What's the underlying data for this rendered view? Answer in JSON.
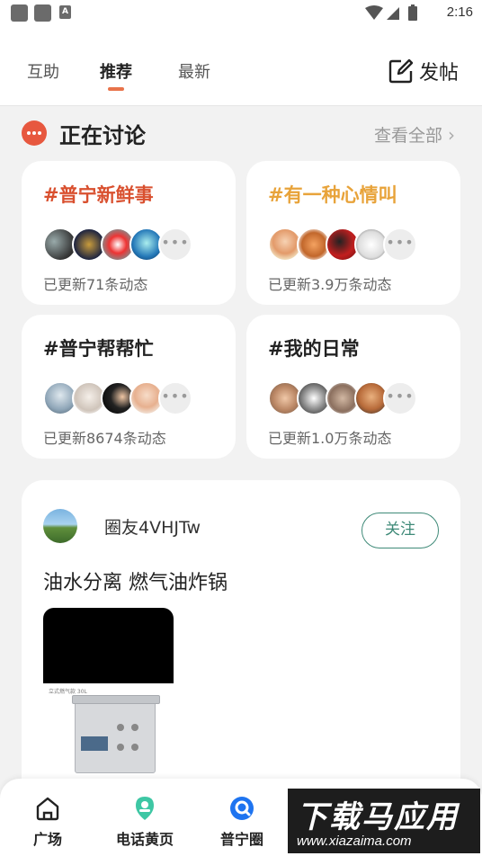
{
  "status_bar": {
    "time": "2:16",
    "a_icon": "A"
  },
  "header": {
    "tabs": [
      {
        "label": "互助",
        "active": false
      },
      {
        "label": "推荐",
        "active": true
      },
      {
        "label": "最新",
        "active": false
      }
    ],
    "post_button_label": "发帖",
    "accent_color": "#e8734a"
  },
  "discussing": {
    "title": "正在讨论",
    "see_all": "查看全部",
    "topics": [
      {
        "title": "#普宁新鲜事",
        "subtitle": "已更新71条动态",
        "title_color": "#d9502f"
      },
      {
        "title": "#有一种心情叫",
        "subtitle": "已更新3.9万条动态",
        "title_color": "#e8a33a"
      },
      {
        "title": "#普宁帮帮忙",
        "subtitle": "已更新8674条动态",
        "title_color": "#222222"
      },
      {
        "title": "#我的日常",
        "subtitle": "已更新1.0万条动态",
        "title_color": "#222222"
      }
    ]
  },
  "post": {
    "username": "圈友4VHJTw",
    "follow_label": "关注",
    "text": "油水分离 燃气油炸锅",
    "image_caption": "立式燃气款 30L"
  },
  "bottom_nav": {
    "items": [
      {
        "label": "广场",
        "icon": "home-icon"
      },
      {
        "label": "电话黄页",
        "icon": "map-pin-icon"
      },
      {
        "label": "普宁圈",
        "icon": "circle-chat-icon"
      }
    ]
  },
  "watermark": {
    "text": "下载马应用",
    "url": "www.xiazaima.com"
  }
}
